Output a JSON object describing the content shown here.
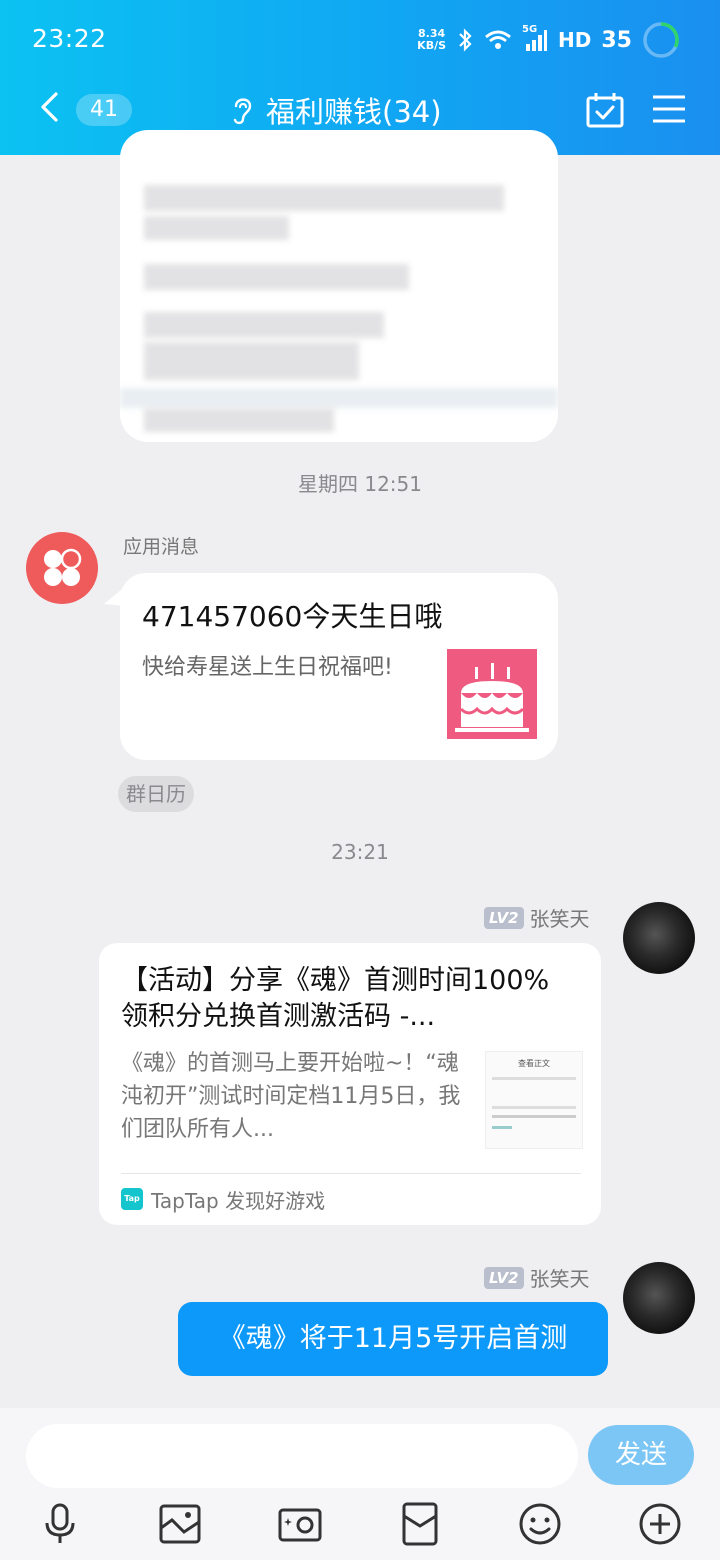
{
  "status_bar": {
    "time": "23:22",
    "net_speed_value": "8.34",
    "net_speed_unit": "KB/S",
    "network": "5G",
    "hd": "HD",
    "battery": "35"
  },
  "header": {
    "unread_count": "41",
    "group_title": "福利赚钱(34)",
    "icons": [
      "back-icon",
      "ear-icon",
      "calendar-check-icon",
      "menu-icon"
    ]
  },
  "messages": {
    "timestamp_1": "星期四 12:51",
    "app_message": {
      "sender": "应用消息",
      "title": "471457060今天生日哦",
      "subtitle": "快给寿星送上生日祝福吧!",
      "tag": "群日历"
    },
    "timestamp_2": "23:21",
    "share": {
      "level": "LV2",
      "sender": "张笑天",
      "title": "【活动】分享《魂》首测时间100%领积分兑换首测激活码 -...",
      "desc": "《魂》的首测马上要开始啦~！“魂沌初开”测试时间定档11月5日，我们团队所有人...",
      "thumb_caption": "查看正文",
      "source": "TapTap 发现好游戏",
      "source_logo_text": "Tap"
    },
    "text_msg": {
      "level": "LV2",
      "sender": "张笑天",
      "text": "《魂》将于11月5号开启首测"
    }
  },
  "input_bar": {
    "placeholder": "",
    "send_label": "发送",
    "tools": [
      "microphone-icon",
      "image-icon",
      "camera-icon",
      "red-packet-icon",
      "emoji-icon",
      "plus-icon"
    ]
  },
  "colors": {
    "header_gradient_start": "#0bc2f2",
    "header_gradient_end": "#1a8ff0",
    "bubble_blue": "#0d99fa",
    "send_button": "#7bc6f5",
    "app_avatar": "#ef5a5a"
  }
}
